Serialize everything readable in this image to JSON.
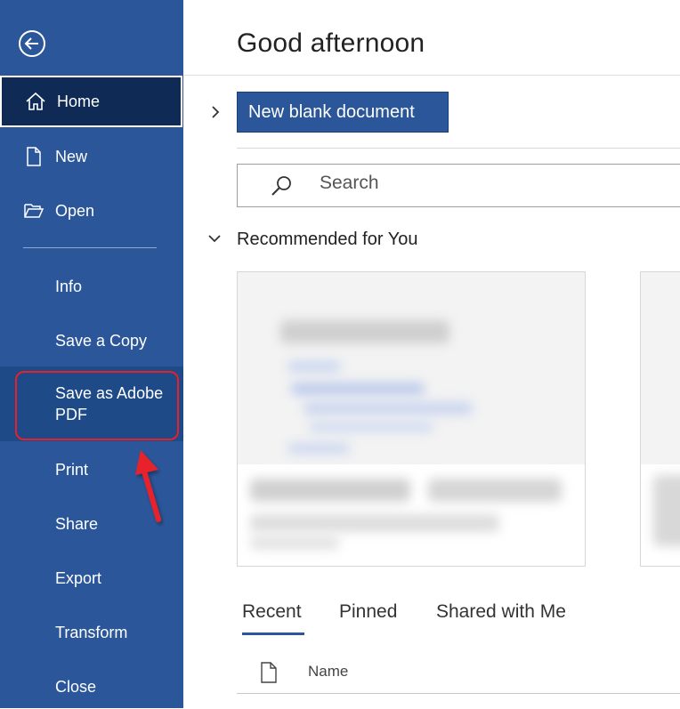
{
  "sidebar": {
    "items": [
      {
        "label": "Home"
      },
      {
        "label": "New"
      },
      {
        "label": "Open"
      },
      {
        "label": "Info"
      },
      {
        "label": "Save a Copy"
      },
      {
        "label": "Save as Adobe PDF"
      },
      {
        "label": "Print"
      },
      {
        "label": "Share"
      },
      {
        "label": "Export"
      },
      {
        "label": "Transform"
      },
      {
        "label": "Close"
      }
    ],
    "adobe_label_line1": "Save as Adobe",
    "adobe_label_line2": "PDF"
  },
  "main": {
    "greeting": "Good afternoon",
    "new_blank_label": "New blank document",
    "search_placeholder": "Search",
    "recommended_title": "Recommended for You",
    "tabs": [
      {
        "label": "Recent",
        "selected": true
      },
      {
        "label": "Pinned",
        "selected": false
      },
      {
        "label": "Shared with Me",
        "selected": false
      }
    ],
    "column_name": "Name"
  },
  "colors": {
    "sidebar": "#2b579a",
    "selected": "#0e2a55",
    "annotation": "#e8202a"
  },
  "icons": {
    "back": "back-arrow-circle-icon",
    "home": "home-icon",
    "new": "document-icon",
    "open": "folder-open-icon",
    "search": "search-icon",
    "file": "file-icon"
  }
}
